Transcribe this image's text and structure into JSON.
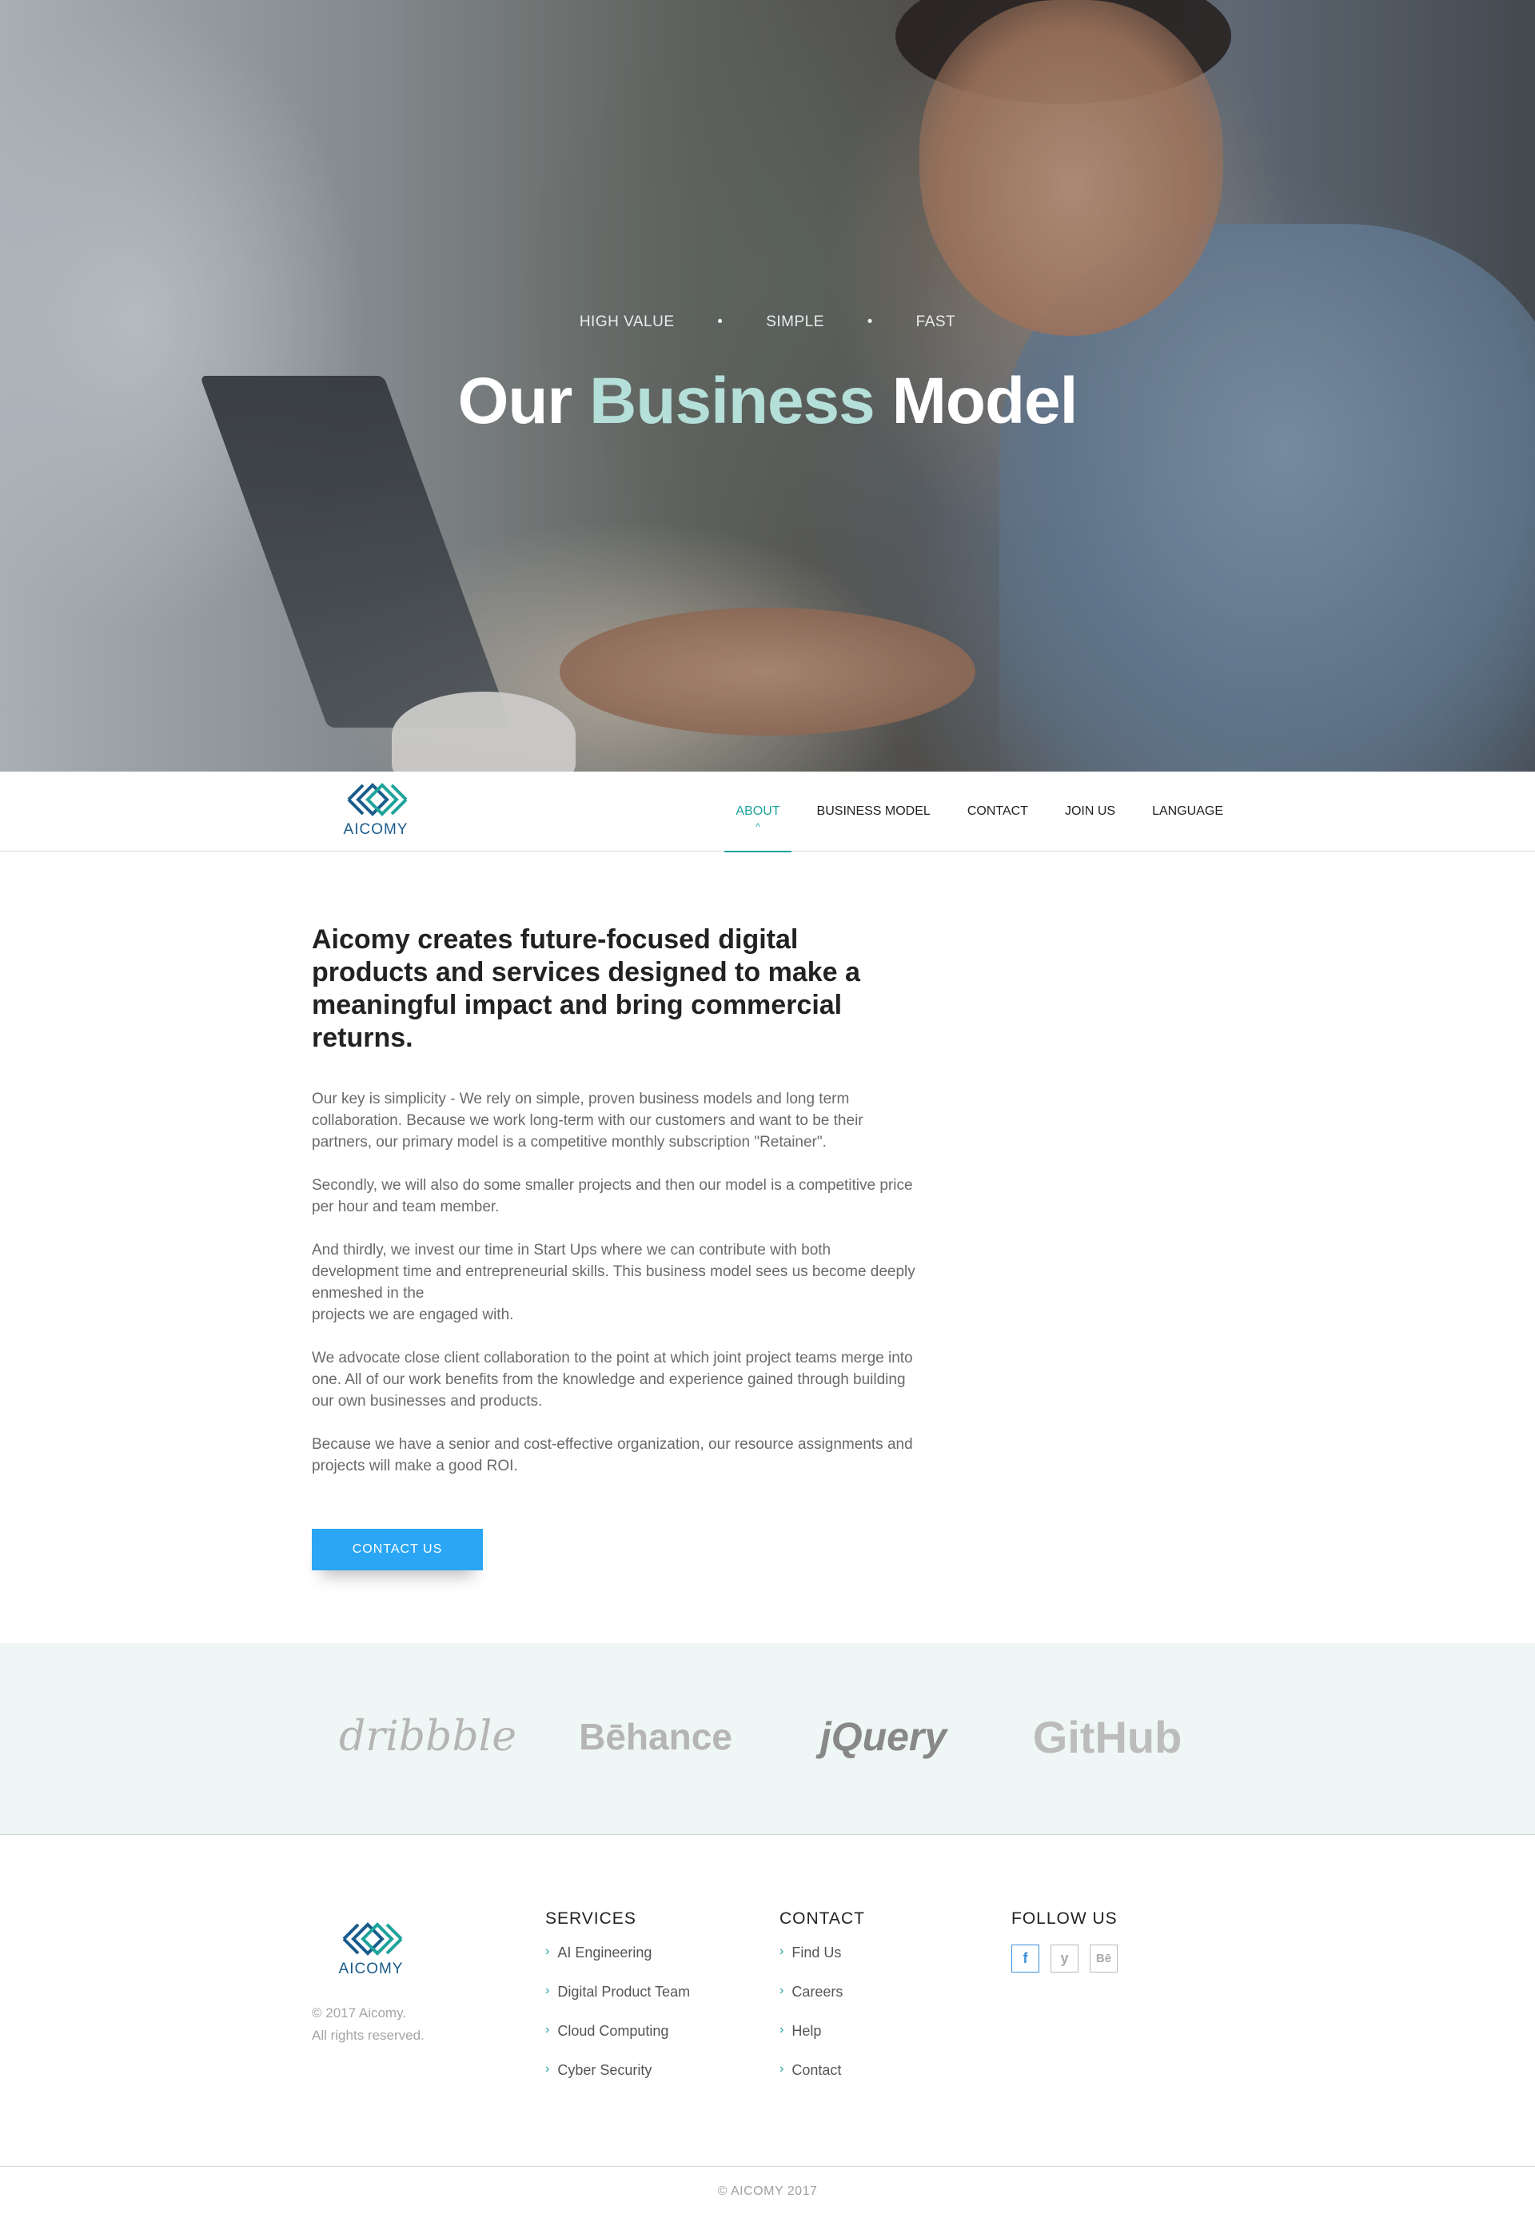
{
  "hero": {
    "tags": [
      "HIGH VALUE",
      "SIMPLE",
      "FAST"
    ],
    "separator": "•",
    "title_part1": "Our",
    "title_accent": "Business",
    "title_part2": "Model"
  },
  "brand": {
    "name": "AICOMY",
    "logo_icon": "aicomy-diamond-logo",
    "color": "#1a5c8c",
    "accent": "#1ea39a"
  },
  "nav": {
    "items": [
      {
        "label": "ABOUT",
        "active": true
      },
      {
        "label": "BUSINESS MODEL"
      },
      {
        "label": "CONTACT"
      },
      {
        "label": "JOIN US"
      },
      {
        "label": "LANGUAGE"
      }
    ],
    "active_caret": "^"
  },
  "content": {
    "heading": "Aicomy creates future-focused digital products and services designed to make a meaningful impact and bring commercial returns.",
    "paragraphs": [
      "Our key is simplicity - We rely on simple, proven business models and long term collaboration. Because we work long-term with our customers and want to be their partners, our primary model is a competitive monthly subscription \"Retainer\".",
      "Secondly, we will also do some smaller projects and then our model is a competitive price per hour and team member.",
      "And thirdly, we invest our time in Start Ups where we can contribute with both development time and entrepreneurial skills. This business model sees us become deeply enmeshed in the",
      "projects we are engaged with.",
      "We advocate close client collaboration to the point at which joint project teams merge into one. All of our work benefits from the knowledge and experience gained through building our own businesses and products.",
      "Because we have a senior and cost-effective organization, our resource assignments and projects will make a good ROI."
    ],
    "cta_label": "CONTACT US",
    "cta_color": "#2aa6f5"
  },
  "partners": [
    "dribbble",
    "Bēhance",
    "jQuery",
    "GitHub"
  ],
  "footer": {
    "copyright_line1": "© 2017 Aicomy.",
    "copyright_line2": "All rights reserved.",
    "services": {
      "title": "SERVICES",
      "items": [
        "AI Engineering",
        "Digital Product Team",
        "Cloud Computing",
        "Cyber Security"
      ]
    },
    "contact": {
      "title": "CONTACT",
      "items": [
        "Find Us",
        "Careers",
        "Help",
        "Contact"
      ]
    },
    "follow": {
      "title": "FOLLOW US",
      "icons": [
        {
          "name": "facebook-icon",
          "glyph": "f"
        },
        {
          "name": "twitter-icon",
          "glyph": "y"
        },
        {
          "name": "behance-icon",
          "glyph": "Bē"
        }
      ]
    },
    "chevron": "›",
    "bottom": "© AICOMY 2017"
  }
}
